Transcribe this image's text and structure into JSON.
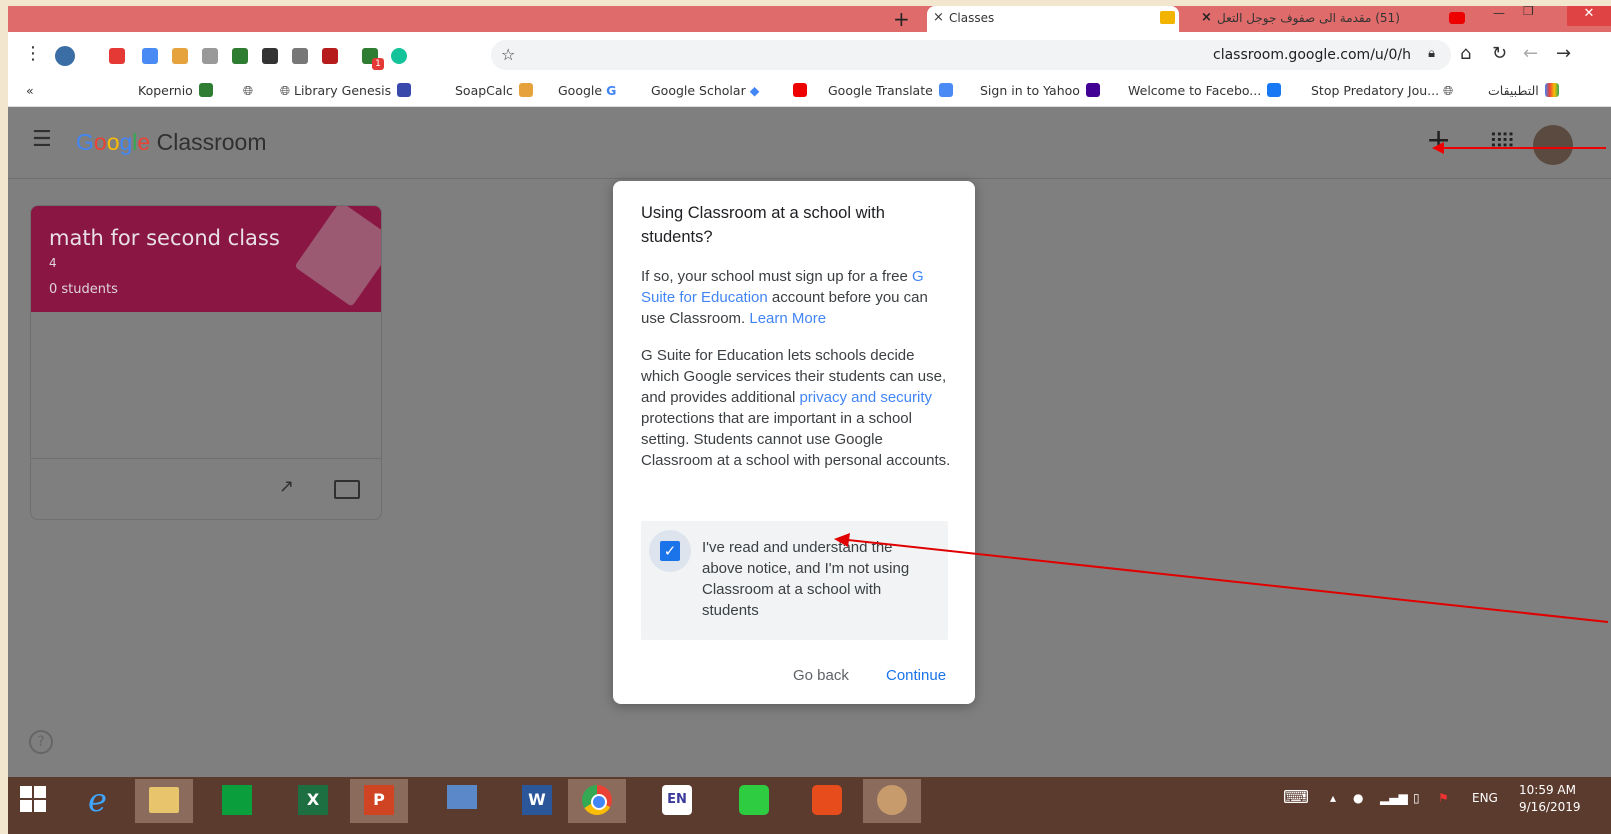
{
  "browser": {
    "tab_active_title": "Classes",
    "tab_youtube_title": "(51) مقدمة الى صفوف جوجل التعل",
    "tab_close": "×",
    "new_tab": "+",
    "url": "classroom.google.com/u/0/h",
    "bookmarks": [
      "Kopernio",
      "Library Genesis",
      "SoapCalc",
      "Google",
      "Google Scholar",
      "Google Translate",
      "Sign in to Yahoo",
      "Welcome to Facebo...",
      "Stop Predatory Jou...",
      "التطبيقات"
    ],
    "bookmarks_more": "«",
    "extension_badge": "1"
  },
  "classroom": {
    "brand_google": [
      "G",
      "o",
      "o",
      "g",
      "l",
      "e"
    ],
    "brand_product": "Classroom",
    "add_icon": "+",
    "card": {
      "title": "math for second class",
      "section": "4",
      "students": "0 students"
    },
    "help": "?"
  },
  "dialog": {
    "title": "Using Classroom at a school with students?",
    "p1_pre": "If so, your school must sign up for a free ",
    "p1_link1": "G Suite for Education",
    "p1_mid": " account before you can use Classroom. ",
    "p1_link2": "Learn More",
    "p2_pre": "G Suite for Education lets schools decide which Google services their students can use, and provides additional ",
    "p2_link": "privacy and security",
    "p2_post": " protections that are important in a school setting. Students cannot use Google Classroom at a school with personal accounts.",
    "ack_checked": true,
    "ack_text": "I've read and understand the above notice, and I'm not using Classroom at a school with students",
    "go_back": "Go back",
    "continue": "Continue"
  },
  "taskbar": {
    "lang": "ENG",
    "time": "10:59 AM",
    "date": "9/16/2019",
    "en_badge": "EN"
  },
  "colors": {
    "tabbar": "#e06b6b",
    "card_header": "#8a1644",
    "accent": "#1a73e8",
    "annotation_arrow": "#e00000",
    "taskbar": "#5b3b2e"
  }
}
